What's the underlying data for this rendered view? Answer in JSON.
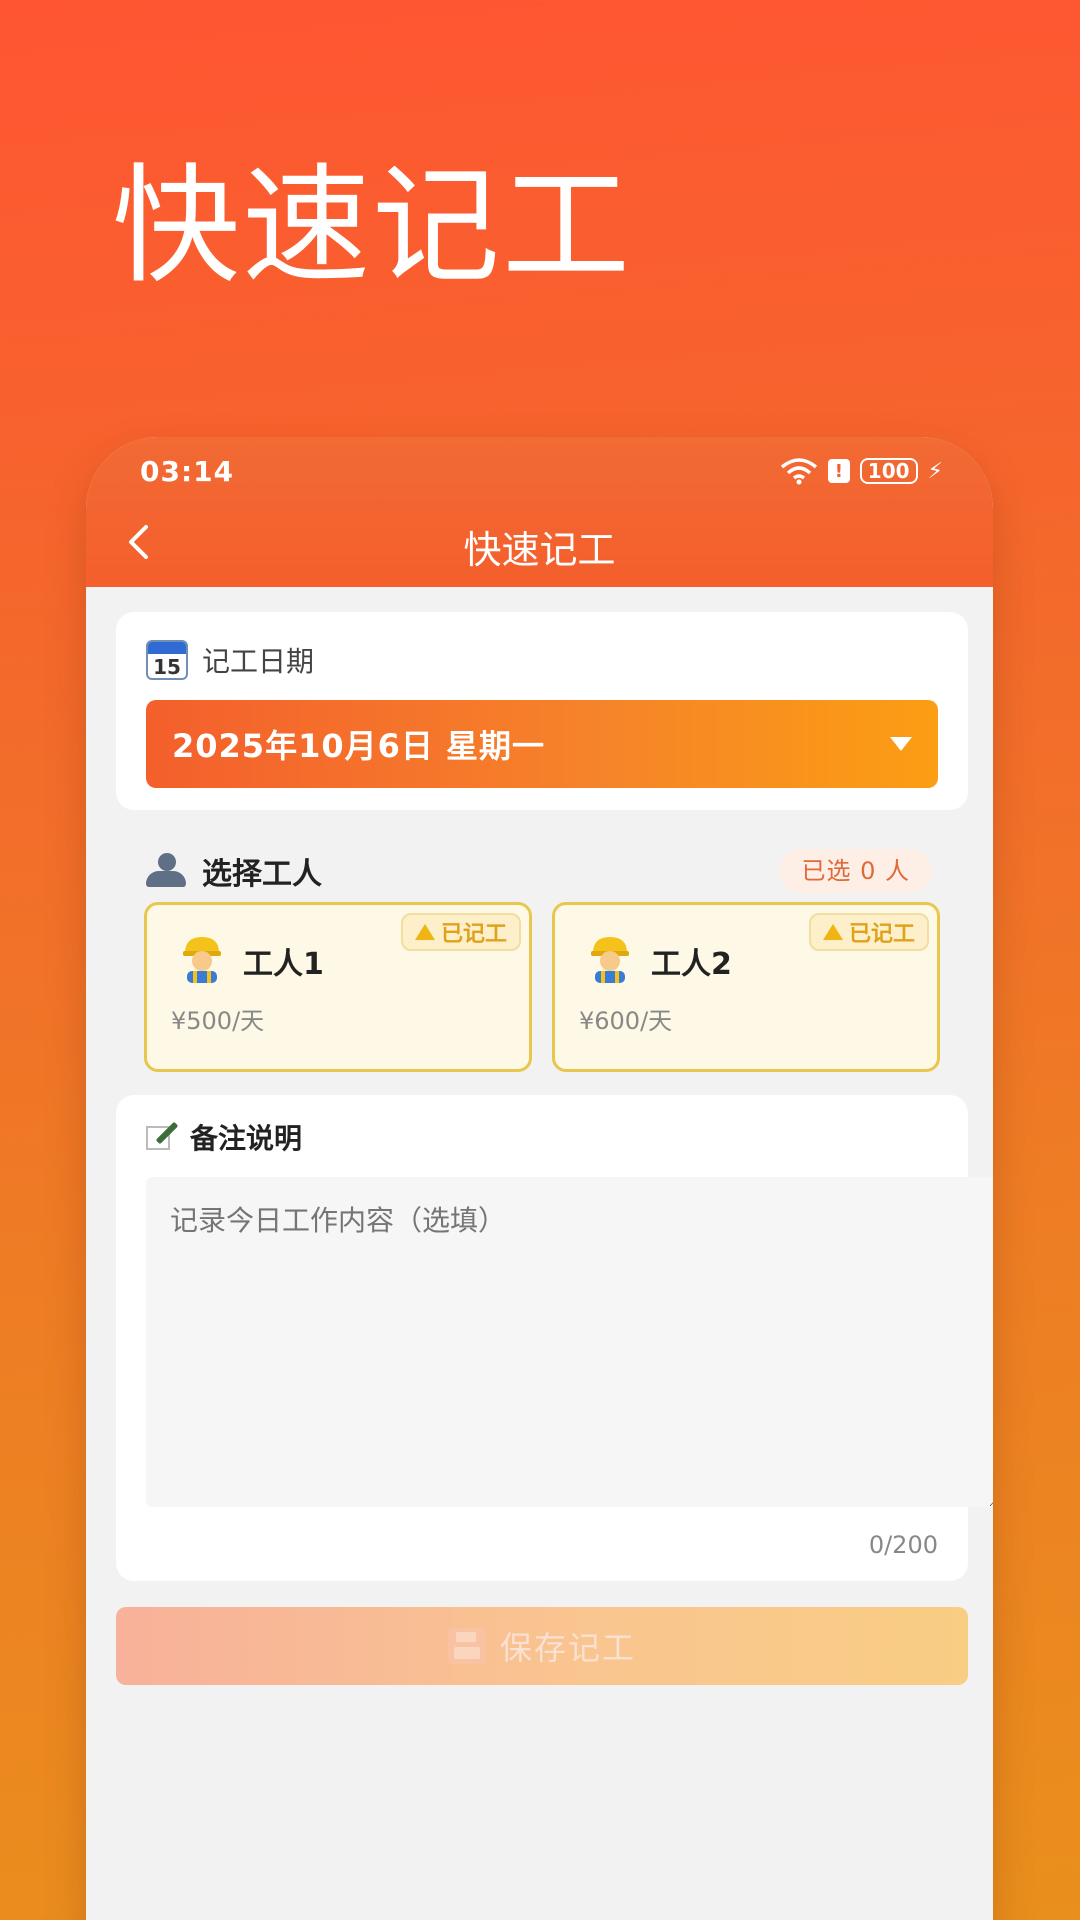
{
  "hero": {
    "title": "快速记工"
  },
  "status_bar": {
    "time": "03:14",
    "battery": "100"
  },
  "header": {
    "title": "快速记工"
  },
  "date_section": {
    "label": "记工日期",
    "calendar_day": "15",
    "selected_date": "2025年10月6日 星期一"
  },
  "worker_section": {
    "title": "选择工人",
    "selected_count_text": "已选 0 人",
    "workers": [
      {
        "name": "工人1",
        "rate": "¥500/天",
        "badge": "已记工"
      },
      {
        "name": "工人2",
        "rate": "¥600/天",
        "badge": "已记工"
      }
    ]
  },
  "notes_section": {
    "title": "备注说明",
    "placeholder": "记录今日工作内容（选填）",
    "value": "",
    "count": "0/200"
  },
  "save_button": {
    "label": "保存记工"
  },
  "colors": {
    "accent": "#f45f2c",
    "accent_end": "#fb9e13",
    "badge_bg": "#fcefc9",
    "worker_card_bg": "#fef9e6",
    "worker_card_border": "#e8c74f"
  }
}
